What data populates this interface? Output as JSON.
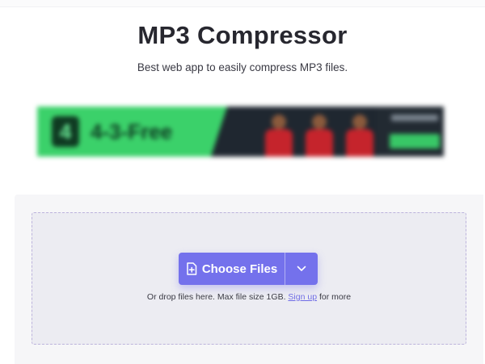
{
  "header": {
    "title": "MP3 Compressor",
    "subtitle": "Best web app to easily compress MP3 files."
  },
  "ad_banner": {
    "number": "4",
    "text": "4-3-Free"
  },
  "upload": {
    "choose_files_label": "Choose Files",
    "hint_prefix": "Or drop files here. Max file size 1GB.",
    "signup_link": "Sign up",
    "hint_suffix": "for more"
  },
  "icons": {
    "file_add": "file-plus-icon",
    "dropdown": "chevron-down-icon"
  },
  "colors": {
    "accent": "#7471ec",
    "link": "#6f6ce6",
    "title": "#27272f",
    "dropzone_bg": "#ececf2",
    "dropzone_border": "#bcb3dc",
    "ad_green": "#3bd16a"
  }
}
